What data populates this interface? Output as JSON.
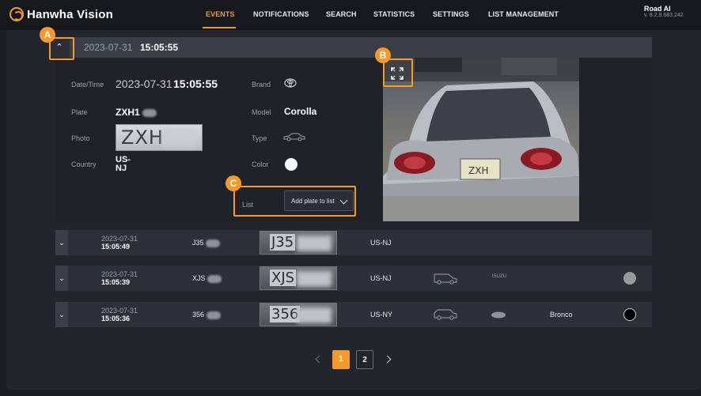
{
  "app": {
    "logo_text": "Hanwha Vision",
    "product": "Road AI",
    "version": "v. 8.2.9.683.242"
  },
  "nav": {
    "items": [
      "EVENTS",
      "NOTIFICATIONS",
      "SEARCH",
      "STATISTICS",
      "SETTINGS",
      "LIST MANAGEMENT"
    ],
    "active": "EVENTS"
  },
  "expanded": {
    "date": "2023-07-31",
    "time": "15:05:55",
    "labels": {
      "datetime": "Date/Time",
      "plate": "Plate",
      "photo": "Photo",
      "country": "Country",
      "brand": "Brand",
      "model": "Model",
      "type": "Type",
      "color": "Color",
      "list": "List"
    },
    "plate": "ZXH1",
    "plate_photo_text": "ZXH",
    "country": "US-NJ",
    "model": "Corolla",
    "color": "#ffffff",
    "list_select": {
      "placeholder": "Add plate to list"
    },
    "photo_plate_text": "ZXH",
    "icons": {
      "brand": "toyota-logo-icon",
      "type": "sedan-icon",
      "fullscreen": "expand-icon"
    }
  },
  "rows": [
    {
      "date": "2023-07-31",
      "time": "15:05:49",
      "plate": "J35",
      "plate_img": "J35",
      "country": "US-NJ",
      "model": "",
      "brand": "",
      "color": ""
    },
    {
      "date": "2023-07-31",
      "time": "15:05:39",
      "plate": "XJS",
      "plate_img": "XJS",
      "country": "US-NJ",
      "model": "",
      "brand": "ISUZU",
      "color": "#9a9a9a"
    },
    {
      "date": "2023-07-31",
      "time": "15:05:36",
      "plate": "356",
      "plate_img": "356",
      "country": "US-NY",
      "model": "Bronco",
      "brand": "Ford",
      "color": "#000000"
    }
  ],
  "pagination": {
    "pages": [
      "1",
      "2"
    ],
    "active": "1"
  },
  "annotations": {
    "a": "A",
    "b": "B",
    "c": "C"
  },
  "accent": "#f39a2a"
}
